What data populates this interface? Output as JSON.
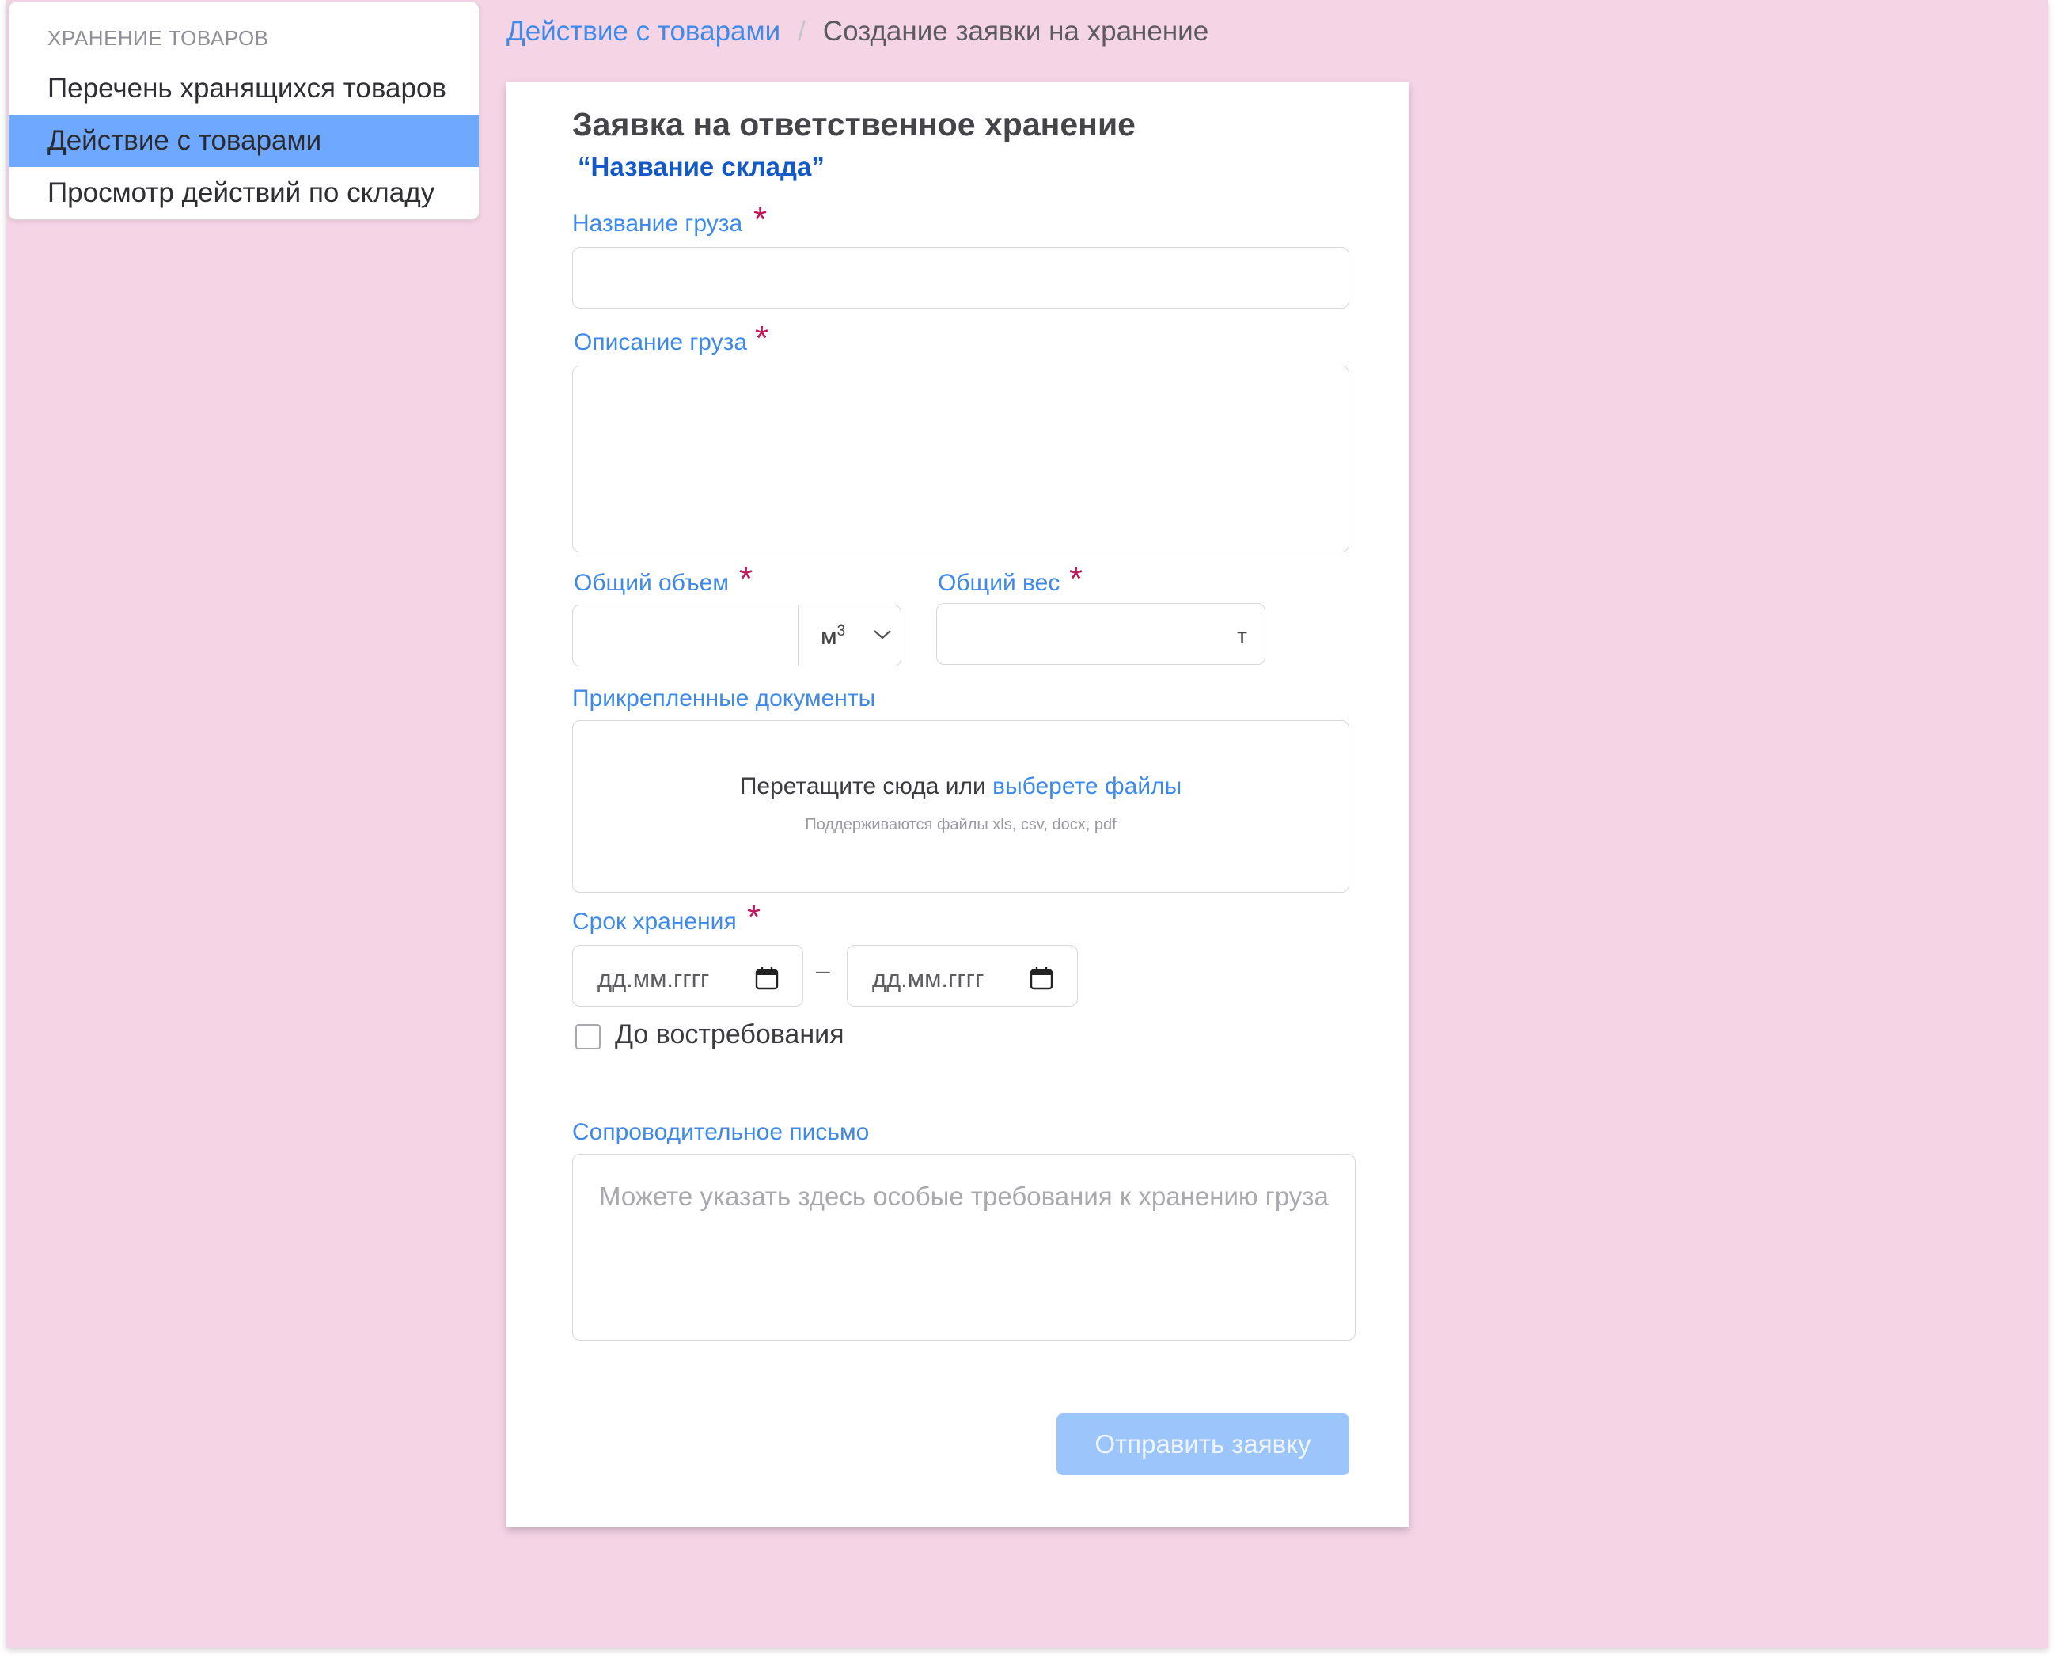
{
  "sidebar": {
    "heading": "ХРАНЕНИЕ ТОВАРОВ",
    "items": [
      {
        "label": "Перечень хранящихся товаров"
      },
      {
        "label": "Действие с товарами"
      },
      {
        "label": "Просмотр действий по складу"
      }
    ]
  },
  "breadcrumb": {
    "link": "Действие с товарами",
    "separator": "/",
    "current": "Создание заявки на хранение"
  },
  "form": {
    "title": "Заявка на ответственное хранение",
    "subtitle": "“Название склада”",
    "required_marker": "*",
    "cargo_name": {
      "label": "Название груза",
      "value": ""
    },
    "cargo_description": {
      "label": "Описание груза",
      "value": ""
    },
    "volume": {
      "label": "Общий объем",
      "value": "",
      "unit": "м",
      "unit_exp": "3"
    },
    "weight": {
      "label": "Общий вес",
      "value": "",
      "unit": "т"
    },
    "documents": {
      "label": "Прикрепленные документы",
      "drop_text": "Перетащите сюда или",
      "drop_link": "выберете файлы",
      "hint": "Поддерживаются файлы xls, csv, docx, pdf"
    },
    "storage_period": {
      "label": "Срок хранения",
      "from_placeholder": "дд.мм.гггг",
      "to_placeholder": "дд.мм.гггг",
      "dash": "–",
      "until_demand_label": "До востребования",
      "until_demand_checked": false
    },
    "cover_letter": {
      "label": "Сопроводительное письмо",
      "placeholder": "Можете указать здесь особые требования к хранению груза"
    },
    "submit_label": "Отправить заявку"
  },
  "colors": {
    "background": "#f5d4e6",
    "accent": "#3f8ae8",
    "active_item": "#6fa8ff",
    "required": "#c2185b",
    "submit_disabled": "#9cc5fb"
  }
}
